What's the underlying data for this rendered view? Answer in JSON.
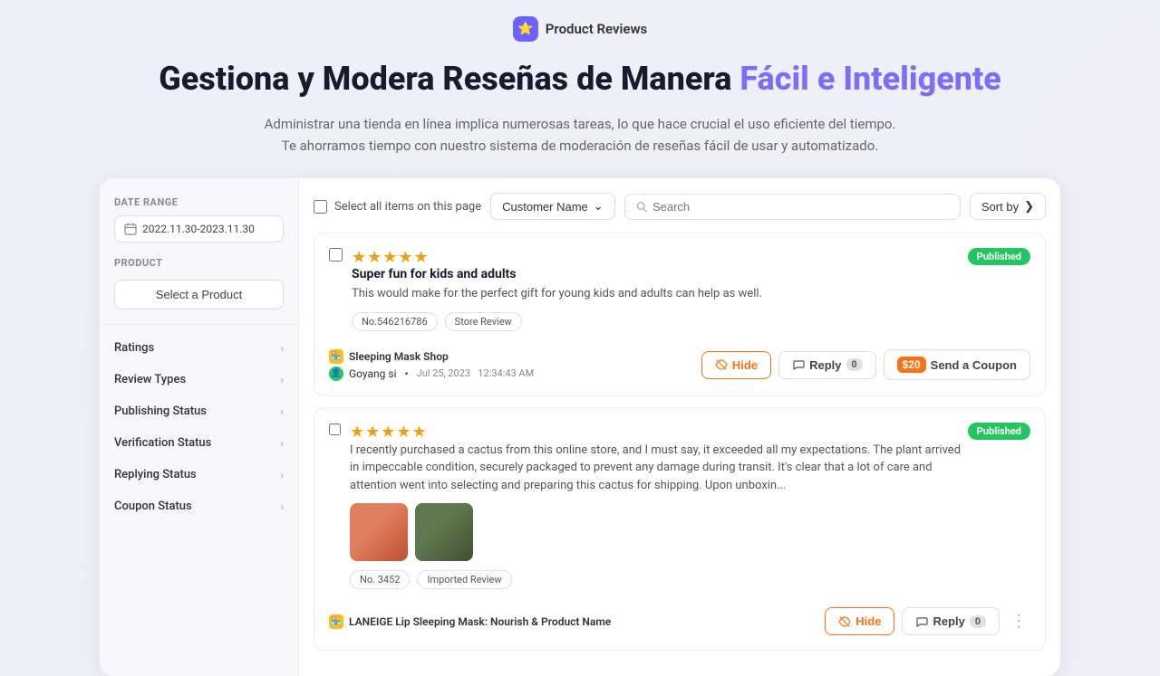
{
  "topbar": {
    "icon": "⭐",
    "title": "Product Reviews"
  },
  "hero": {
    "heading_plain": "Gestiona y Modera Reseñas de Manera ",
    "heading_highlight": "Fácil e Inteligente",
    "subtext_line1": "Administrar una tienda en línea implica numerosas tareas, lo que hace crucial el uso eficiente del tiempo.",
    "subtext_line2": "Te ahorramos tiempo con nuestro sistema de moderación de reseñas fácil de usar y automatizado."
  },
  "sidebar": {
    "date_range_label": "Date Range",
    "date_value": "2022.11.30-2023.11.30",
    "product_label": "Product",
    "product_btn": "Select a Product",
    "filters": [
      {
        "label": "Ratings"
      },
      {
        "label": "Review Types"
      },
      {
        "label": "Publishing Status"
      },
      {
        "label": "Verification Status"
      },
      {
        "label": "Replying Status"
      },
      {
        "label": "Coupon Status"
      }
    ]
  },
  "toolbar": {
    "select_all_label": "Select all items on this page",
    "customer_dropdown": "Customer Name",
    "search_placeholder": "Search",
    "sort_label": "Sort by"
  },
  "reviews": [
    {
      "id": 1,
      "stars": "★★★★★",
      "status": "Published",
      "title": "Super fun for kids and adults",
      "body": "This would make for the perfect gift for young kids and adults can help as well.",
      "tags": [
        "No.546216786",
        "Store Review"
      ],
      "shop": "Sleeping Mask Shop",
      "user": "Goyang si",
      "date": "Jul 25, 2023",
      "time": "12:34:43 AM",
      "actions": {
        "hide": "Hide",
        "reply": "Reply",
        "reply_count": "0",
        "coupon_amount": "$20",
        "coupon": "Send a Coupon"
      },
      "images": []
    },
    {
      "id": 2,
      "stars": "★★★★★",
      "status": "Published",
      "title": "",
      "body": "I recently purchased a cactus from this online store, and I must say, it exceeded all my expectations. The plant arrived in impeccable condition, securely packaged to prevent any damage during transit. It's clear that a lot of care and attention went into selecting and preparing this cactus for shipping. Upon unboxin...",
      "tags": [
        "No. 3452",
        "Imported Review"
      ],
      "shop": "LANEIGE Lip Sleeping Mask: Nourish & Product Name",
      "user": "",
      "date": "",
      "time": "",
      "actions": {
        "hide": "Hide",
        "reply": "Reply",
        "reply_count": "0",
        "coupon_amount": "",
        "coupon": ""
      },
      "images": [
        "cactus1",
        "cactus2"
      ]
    }
  ]
}
